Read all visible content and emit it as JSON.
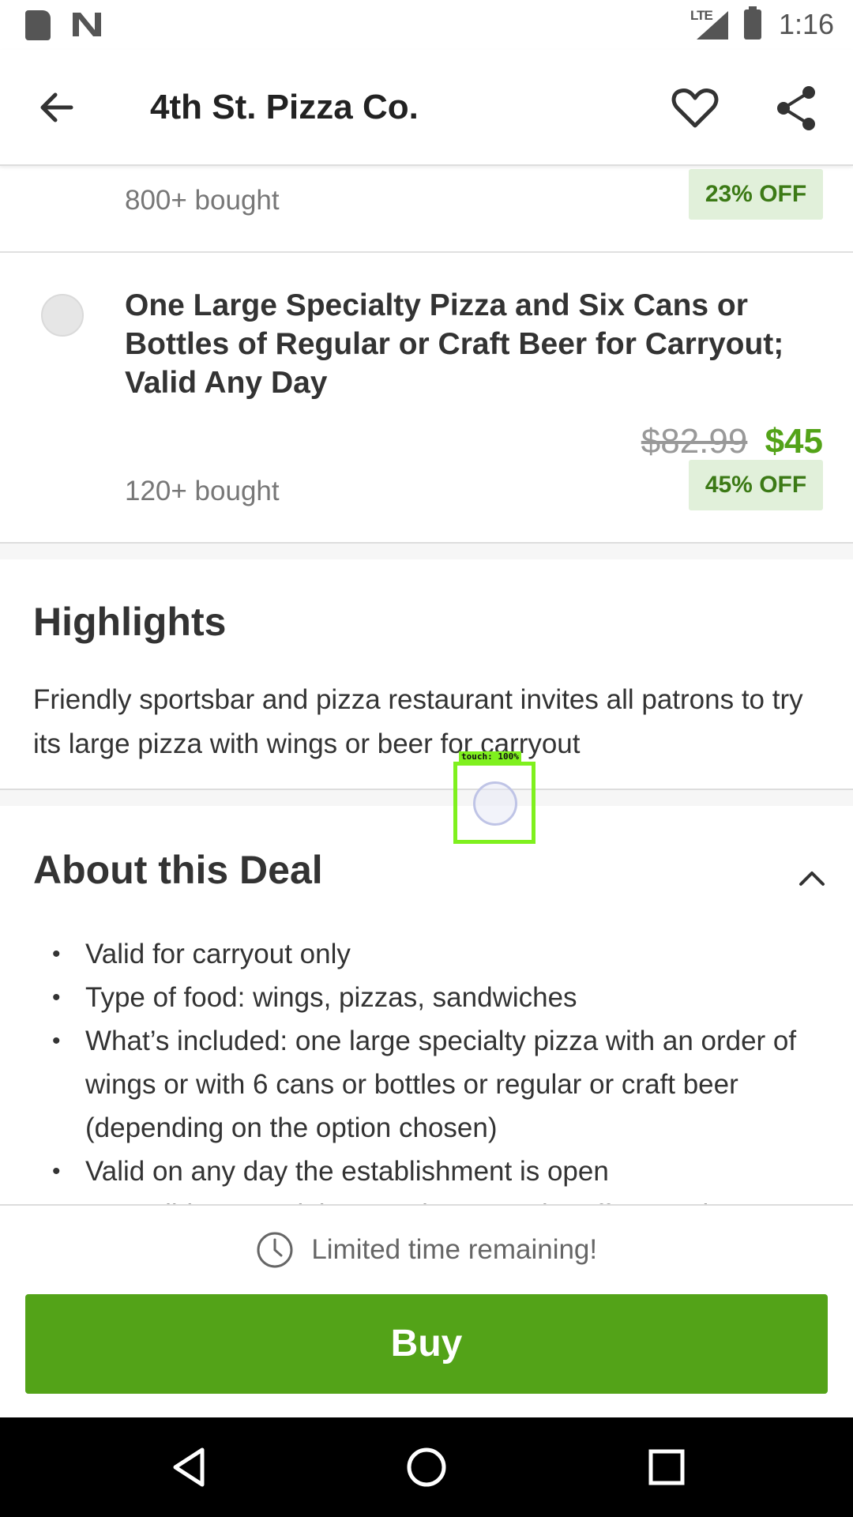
{
  "status_bar": {
    "network": "LTE",
    "time": "1:16"
  },
  "app_bar": {
    "title": "4th St. Pizza Co."
  },
  "options": [
    {
      "bought": "800+ bought",
      "discount": "23% OFF"
    },
    {
      "title": "One Large Specialty Pizza and Six Cans or Bottles of Regular or Craft Beer for Carryout; Valid Any Day",
      "original_price": "$82.99",
      "price": "$45",
      "bought": "120+ bought",
      "discount": "45% OFF"
    }
  ],
  "highlights": {
    "heading": "Highlights",
    "body": "Friendly sportsbar and pizza restaurant invites all patrons to try its large pizza with wings or beer for carryout"
  },
  "about": {
    "heading": "About this Deal",
    "bullets": [
      "Valid for carryout only",
      "Type of food: wings, pizzas, sandwiches",
      "What’s included: one large specialty pizza with an order of wings or with 6 cans or bottles or regular or craft beer (depending on the option chosen)",
      "Valid on any day the establishment is open",
      "Not valid on special events because the offer may be"
    ]
  },
  "bottom": {
    "limited_text": "Limited time remaining!",
    "buy_label": "Buy"
  },
  "touch": {
    "label": "touch: 100%"
  },
  "colors": {
    "accent_green": "#53a318",
    "badge_bg": "#e1f0da",
    "badge_text": "#3c7a16",
    "touch_box": "#7ff01e"
  }
}
